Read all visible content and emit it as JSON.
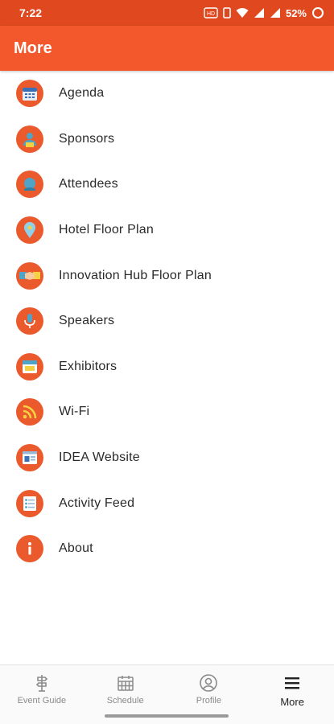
{
  "status_bar": {
    "time": "7:22",
    "battery": "52%"
  },
  "header": {
    "title": "More"
  },
  "menu": {
    "items": [
      {
        "label": "Agenda",
        "icon": "calendar-icon"
      },
      {
        "label": "Sponsors",
        "icon": "sponsor-icon"
      },
      {
        "label": "Attendees",
        "icon": "attendees-icon"
      },
      {
        "label": "Hotel Floor Plan",
        "icon": "map-pin-icon"
      },
      {
        "label": "Innovation Hub Floor Plan",
        "icon": "handshake-icon"
      },
      {
        "label": "Speakers",
        "icon": "microphone-icon"
      },
      {
        "label": "Exhibitors",
        "icon": "booth-icon"
      },
      {
        "label": "Wi-Fi",
        "icon": "wifi-icon"
      },
      {
        "label": "IDEA Website",
        "icon": "website-icon"
      },
      {
        "label": "Activity Feed",
        "icon": "feed-icon"
      },
      {
        "label": "About",
        "icon": "info-icon"
      }
    ]
  },
  "bottom_nav": {
    "items": [
      {
        "label": "Event Guide",
        "icon": "signpost-icon"
      },
      {
        "label": "Schedule",
        "icon": "calendar-icon"
      },
      {
        "label": "Profile",
        "icon": "profile-icon"
      },
      {
        "label": "More",
        "icon": "hamburger-icon"
      }
    ],
    "active": "More"
  },
  "colors": {
    "status_bar": "#e0491f",
    "app_bar": "#f2582c",
    "icon_circle": "#ea5a2c"
  }
}
